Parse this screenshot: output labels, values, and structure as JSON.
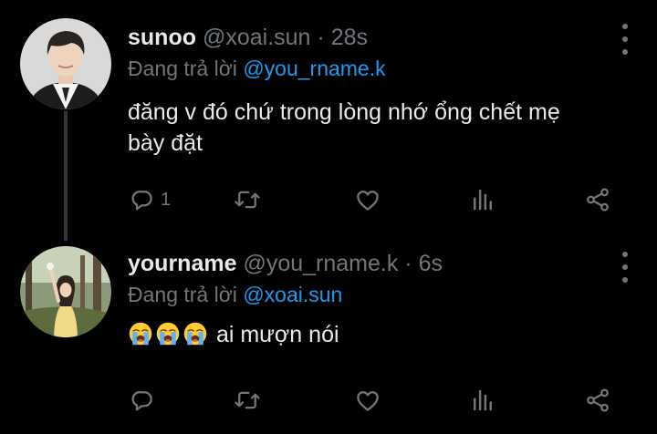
{
  "tweets": [
    {
      "display_name": "sunoo",
      "handle": "@xoai.sun",
      "separator": "·",
      "time": "28s",
      "reply_prefix": "Đang trả lời",
      "reply_to": "@you_rname.k",
      "line1": "đăng v đó chứ trong lòng nhớ ổng chết mẹ",
      "line2": "bày đặt",
      "reply_count": "1"
    },
    {
      "display_name": "yourname",
      "handle": "@you_rname.k",
      "separator": "·",
      "time": "6s",
      "reply_prefix": "Đang trả lời",
      "reply_to": "@xoai.sun",
      "emojis": [
        "loudly-crying-face",
        "loudly-crying-face",
        "loudly-crying-face"
      ],
      "text": "ai mượn nói"
    }
  ],
  "colors": {
    "background": "#000000",
    "text": "#e7e9ea",
    "muted": "#71767b",
    "accent": "#1d9bf0"
  },
  "icons": [
    "reply-icon",
    "retweet-icon",
    "like-icon",
    "views-icon",
    "share-icon",
    "more-options-icon"
  ]
}
